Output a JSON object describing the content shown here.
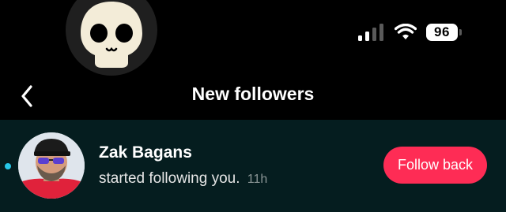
{
  "status_bar": {
    "battery_level": "96",
    "signal_icon": "cellular-signal-icon",
    "wifi_icon": "wifi-icon",
    "profile_icon": "skull-avatar"
  },
  "header": {
    "back_icon": "chevron-left-icon",
    "title": "New followers"
  },
  "notifications": [
    {
      "user_name": "Zak Bagans",
      "activity": "started following you.",
      "time": "11h",
      "action_label": "Follow back",
      "unread": true
    }
  ],
  "colors": {
    "background": "#000000",
    "row_background": "#051d1f",
    "accent": "#fe2c55",
    "unread_dot": "#27c7e8"
  }
}
